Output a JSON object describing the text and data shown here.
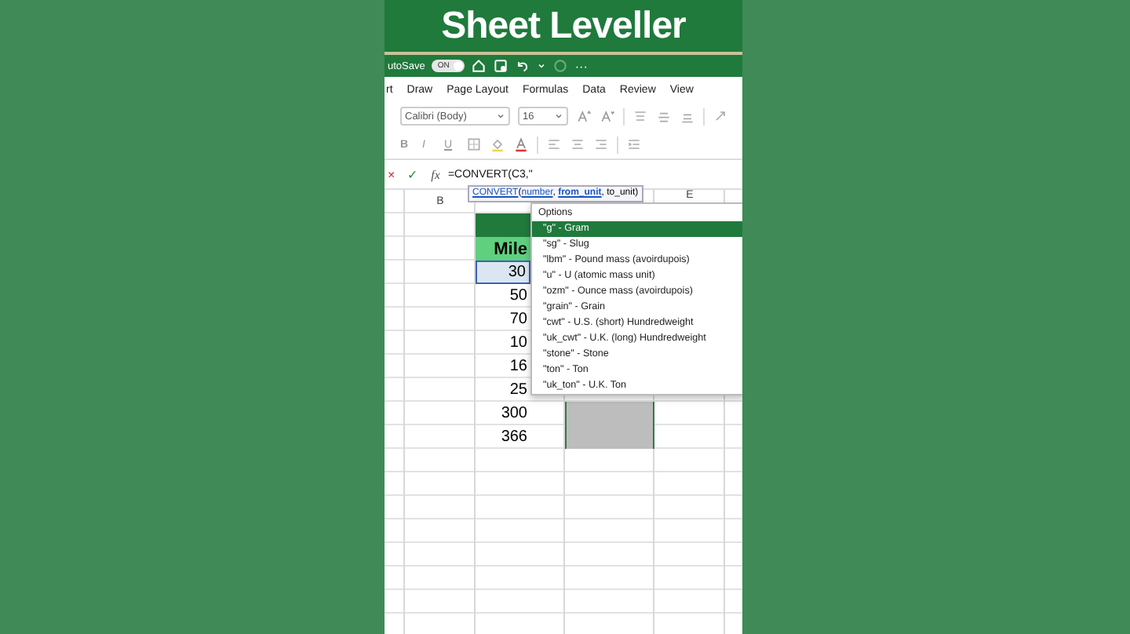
{
  "banner": {
    "title": "Sheet Leveller"
  },
  "quick_access": {
    "autosave_label": "utoSave",
    "autosave_toggle": {
      "label": "ON",
      "on": true
    },
    "more": "···"
  },
  "ribbon_tabs": [
    {
      "label": "rt",
      "selected": false
    },
    {
      "label": "Draw",
      "selected": false
    },
    {
      "label": "Page Layout",
      "selected": false
    },
    {
      "label": "Formulas",
      "selected": false
    },
    {
      "label": "Data",
      "selected": false
    },
    {
      "label": "Review",
      "selected": false
    },
    {
      "label": "View",
      "selected": false
    }
  ],
  "font_name": "Calibri (Body)",
  "font_size": "16",
  "format_buttons": [
    "B",
    "I",
    "U"
  ],
  "formula_bar": {
    "cancel": "×",
    "enter": "✓",
    "fx": "fx",
    "value": "=CONVERT(C3,\""
  },
  "tooltip": [
    {
      "text": "CONVERT",
      "kind": "link"
    },
    {
      "text": "(",
      "kind": "plain"
    },
    {
      "text": "number",
      "kind": "arg"
    },
    {
      "text": ", ",
      "kind": "plain"
    },
    {
      "text": "from_unit",
      "kind": "current"
    },
    {
      "text": ", to_unit)",
      "kind": "plain"
    }
  ],
  "column_headers": {
    "col_b": "B",
    "col_e": "E"
  },
  "rows": [
    {
      "c": "",
      "kind": "band"
    },
    {
      "c": "Mile",
      "kind": "header"
    },
    {
      "c": "30",
      "kind": "value",
      "selected": true
    },
    {
      "c": "50",
      "kind": "value",
      "selected": false
    },
    {
      "c": "70",
      "kind": "value",
      "selected": false
    },
    {
      "c": "10",
      "kind": "value",
      "selected": false
    },
    {
      "c": "16",
      "kind": "value",
      "selected": false
    },
    {
      "c": "25",
      "kind": "value",
      "selected": false
    },
    {
      "c": "300",
      "kind": "value",
      "selected": false,
      "d_selected": true
    },
    {
      "c": "366",
      "kind": "value",
      "selected": false,
      "d_selected": true
    }
  ],
  "options": {
    "title": "Options",
    "items": [
      {
        "label": "\"g\" - Gram",
        "selected": true
      },
      {
        "label": "\"sg\" - Slug",
        "selected": false
      },
      {
        "label": "\"lbm\" - Pound mass (avoirdupois)",
        "selected": false
      },
      {
        "label": "\"u\" - U (atomic mass unit)",
        "selected": false
      },
      {
        "label": "\"ozm\" - Ounce mass (avoirdupois)",
        "selected": false
      },
      {
        "label": "\"grain\" - Grain",
        "selected": false
      },
      {
        "label": "\"cwt\" - U.S. (short) Hundredweight",
        "selected": false
      },
      {
        "label": "\"uk_cwt\" - U.K. (long) Hundredweight",
        "selected": false
      },
      {
        "label": "\"stone\" - Stone",
        "selected": false
      },
      {
        "label": "\"ton\" - Ton",
        "selected": false
      },
      {
        "label": "\"uk_ton\" - U.K. Ton",
        "selected": false
      }
    ]
  }
}
